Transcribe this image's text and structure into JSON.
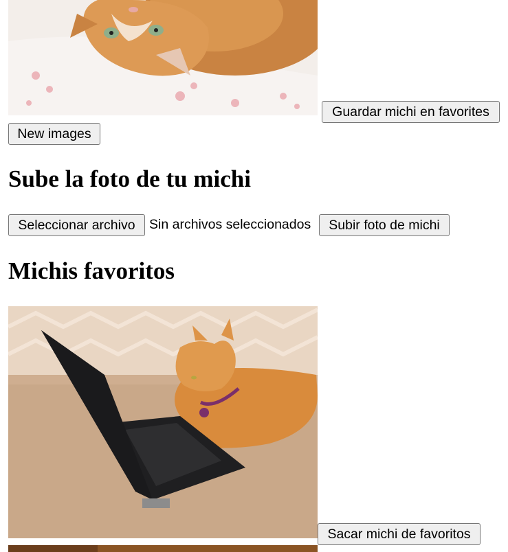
{
  "random_section": {
    "image_alt": "cat lying on floral pillow",
    "save_button_label": "Guardar michi en favorites",
    "new_images_label": "New images"
  },
  "upload_section": {
    "title": "Sube la foto de tu michi",
    "file_button_label": "Seleccionar archivo",
    "file_status": "Sin archivos seleccionados",
    "upload_button_label": "Subir foto de michi"
  },
  "favorites_section": {
    "title": "Michis favoritos",
    "items": [
      {
        "image_alt": "orange cat with black laptop",
        "remove_button_label": "Sacar michi de favoritos"
      }
    ]
  },
  "colors": {
    "button_bg": "#efefef",
    "button_border": "#767676"
  }
}
